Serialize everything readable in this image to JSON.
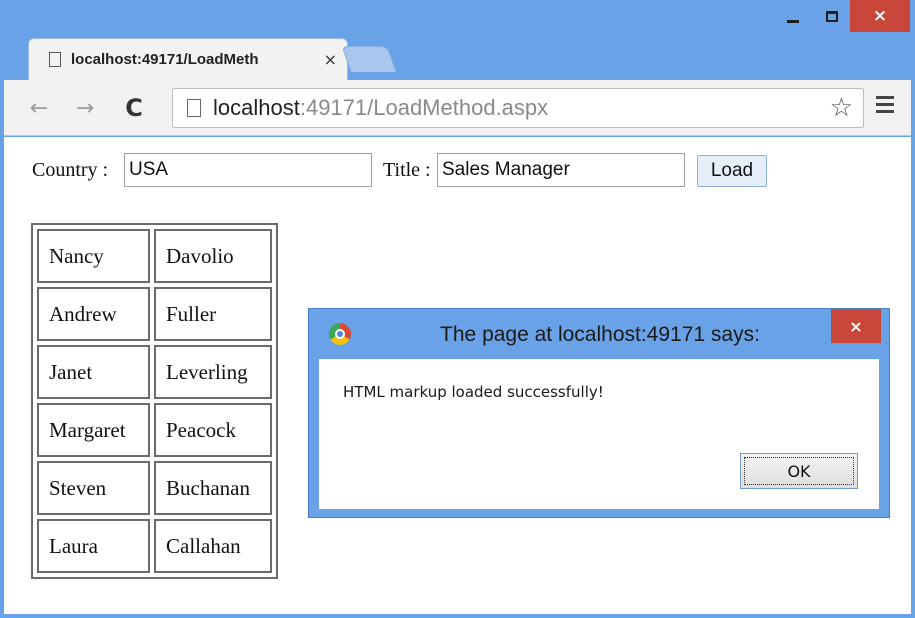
{
  "browser": {
    "tab_title": "localhost:49171/LoadMeth",
    "tab_close": "×",
    "window_close": "×",
    "url_host": "localhost",
    "url_rest": ":49171/LoadMethod.aspx",
    "star": "☆",
    "back": "←",
    "forward": "→",
    "reload": "C"
  },
  "form": {
    "country_label": "Country :",
    "country_value": "USA",
    "title_label": "Title :",
    "title_value": "Sales Manager",
    "load_label": "Load"
  },
  "employees": [
    {
      "first": "Nancy",
      "last": "Davolio"
    },
    {
      "first": "Andrew",
      "last": "Fuller"
    },
    {
      "first": "Janet",
      "last": "Leverling"
    },
    {
      "first": "Margaret",
      "last": "Peacock"
    },
    {
      "first": "Steven",
      "last": "Buchanan"
    },
    {
      "first": "Laura",
      "last": "Callahan"
    }
  ],
  "dialog": {
    "title": "The page at localhost:49171 says:",
    "message": "HTML markup loaded successfully!",
    "ok_label": "OK",
    "close": "×"
  },
  "icons": {
    "tab_page": "page-icon",
    "omnibox_page": "page-icon",
    "bookmark": "star-icon",
    "menu": "hamburger-menu-icon",
    "dialog": "chrome-icon"
  },
  "colors": {
    "frame": "#6aa2e8",
    "close_red": "#c9473a"
  }
}
